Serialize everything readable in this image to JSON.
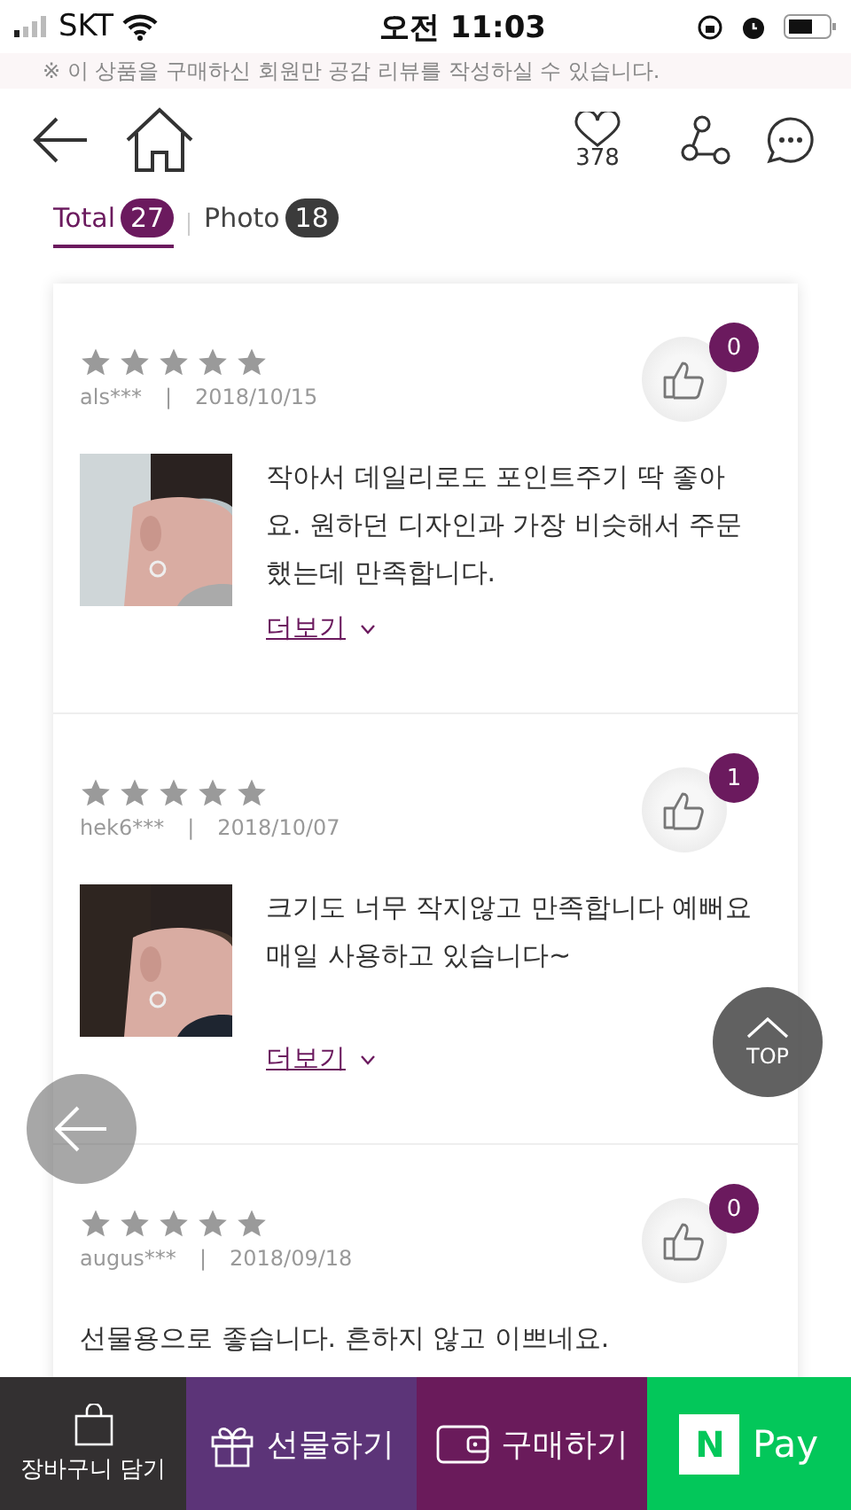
{
  "status_bar": {
    "carrier": "SKT",
    "time": "오전 11:03"
  },
  "header": {
    "wish_count": "378"
  },
  "notice": "※ 이 상품을 구매하신 회원만 공감 리뷰를 작성하실 수 있습니다.",
  "tabs": [
    {
      "label": "Total",
      "count": "27",
      "selected": true
    },
    {
      "label": "Photo",
      "count": "18",
      "selected": false
    }
  ],
  "reviews": [
    {
      "stars": 5,
      "user": "als***",
      "separator": "|",
      "date": "2018/10/15",
      "likes": "0",
      "photo": true,
      "text": "작아서 데일리로도 포인트주기 딱 좋아요. 원하던 디자인과 가장 비슷해서 주문했는데 만족합니다.",
      "more": "더보기"
    },
    {
      "stars": 5,
      "user": "hek6***",
      "separator": "|",
      "date": "2018/10/07",
      "likes": "1",
      "photo": true,
      "text": "크기도 너무 작지않고 만족합니다 예뻐요 매일 사용하고 있습니다~",
      "more": "더보기"
    },
    {
      "stars": 5,
      "user": "augus***",
      "separator": "|",
      "date": "2018/09/18",
      "likes": "0",
      "photo": false,
      "text": "선물용으로 좋습니다. 흔하지 않고 이쁘네요."
    }
  ],
  "top_button": "TOP",
  "bottom_bar": [
    {
      "kind": "cart",
      "label": "장바구니 담기"
    },
    {
      "kind": "gift",
      "label": "선물하기"
    },
    {
      "kind": "buy",
      "label": "구매하기"
    },
    {
      "kind": "npay",
      "label": "Pay",
      "logo": "N"
    }
  ]
}
